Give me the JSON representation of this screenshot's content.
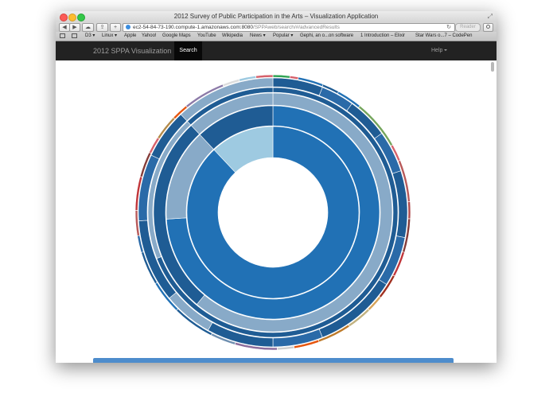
{
  "window": {
    "title": "2012 Survey of Public Participation in the Arts – Visualization Application"
  },
  "toolbar": {
    "back_label": "◀",
    "forward_label": "▶",
    "add_label": "+",
    "url_host": "ec2-54-84-73-190.compute-1.amazonaws.com:8080",
    "url_path": "/SPPAweb/search/#/advancedResults",
    "reader_label": "Reader"
  },
  "bookmarks": [
    "D3 ▾",
    "Linux ▾",
    "Apple",
    "Yahoo!",
    "Google Maps",
    "YouTube",
    "Wikipedia",
    "News ▾",
    "Popular ▾",
    "Gephi, an o...on software",
    "1 Introduction – Elixir",
    "Star Wars o...7 – CodePen"
  ],
  "navbar": {
    "brand": "2012 SPPA Visualization",
    "search_tab": "Search",
    "help_label": "Help"
  },
  "colors": {
    "navbar_bg": "#222222",
    "blue_dark": "#1f5c94",
    "blue_mid": "#2171b5",
    "blue_gray": "#88aac8",
    "blue_light": "#9ecae1",
    "bottom_bar": "#4d8ccc"
  },
  "sunburst": {
    "rings": [
      {
        "segments": [
          {
            "value": 88,
            "color": "#2171b5"
          },
          {
            "value": 12,
            "color": "#9ecae1"
          }
        ]
      },
      {
        "segments": [
          {
            "value": 74,
            "color": "#2171b5"
          },
          {
            "value": 14,
            "color": "#88aac8"
          },
          {
            "value": 12,
            "color": "#1f5c94"
          }
        ]
      },
      {
        "segments": [
          {
            "value": 61,
            "color": "#88aac8"
          },
          {
            "value": 27,
            "color": "#1f5c94"
          },
          {
            "value": 12,
            "color": "#88aac8"
          }
        ]
      },
      {
        "segments": [
          {
            "value": 69,
            "color": "#1f5c94"
          },
          {
            "value": 19,
            "color": "#88aac8"
          },
          {
            "value": 12,
            "color": "#1f5c94"
          }
        ]
      },
      {
        "segments": [
          {
            "value": 6,
            "color": "#1f5c94"
          },
          {
            "value": 4,
            "color": "#2a6aa8"
          },
          {
            "value": 5,
            "color": "#1f5c94"
          },
          {
            "value": 5,
            "color": "#2a6aa8"
          },
          {
            "value": 8,
            "color": "#1f5c94"
          },
          {
            "value": 6,
            "color": "#2a6aa8"
          },
          {
            "value": 10,
            "color": "#1f5c94"
          },
          {
            "value": 6,
            "color": "#2a6aa8"
          },
          {
            "value": 8,
            "color": "#1f5c94"
          },
          {
            "value": 6,
            "color": "#88aac8"
          },
          {
            "value": 10,
            "color": "#1f5c94"
          },
          {
            "value": 8,
            "color": "#2a6aa8"
          },
          {
            "value": 6,
            "color": "#1f5c94"
          },
          {
            "value": 12,
            "color": "#88aac8"
          }
        ]
      },
      {
        "segments": [
          {
            "value": 2,
            "color": "#31a354"
          },
          {
            "value": 1,
            "color": "#d6616b"
          },
          {
            "value": 3,
            "color": "#2171b5"
          },
          {
            "value": 2,
            "color": "#1f5c94"
          },
          {
            "value": 3,
            "color": "#2171b5"
          },
          {
            "value": 6,
            "color": "#74a55c"
          },
          {
            "value": 2,
            "color": "#d6616b"
          },
          {
            "value": 5,
            "color": "#b85a5a"
          },
          {
            "value": 2,
            "color": "#ad494a"
          },
          {
            "value": 4,
            "color": "#843c39"
          },
          {
            "value": 3,
            "color": "#c0353a"
          },
          {
            "value": 3,
            "color": "#a03020"
          },
          {
            "value": 2,
            "color": "#d6a35a"
          },
          {
            "value": 3,
            "color": "#c2b280"
          },
          {
            "value": 4,
            "color": "#bd7a2a"
          },
          {
            "value": 3,
            "color": "#e6550d"
          },
          {
            "value": 2,
            "color": "#cfcfcf"
          },
          {
            "value": 5,
            "color": "#8c6d9c"
          },
          {
            "value": 3,
            "color": "#6e8fb0"
          },
          {
            "value": 5,
            "color": "#1f5c94"
          },
          {
            "value": 4,
            "color": "#2171b5"
          },
          {
            "value": 4,
            "color": "#1f5c94"
          },
          {
            "value": 2,
            "color": "#2a6aa8"
          },
          {
            "value": 3,
            "color": "#b85a5a"
          },
          {
            "value": 4,
            "color": "#c0353a"
          },
          {
            "value": 3,
            "color": "#843c39"
          },
          {
            "value": 2,
            "color": "#d6616b"
          },
          {
            "value": 3,
            "color": "#b38a4a"
          },
          {
            "value": 2,
            "color": "#e6550d"
          },
          {
            "value": 5,
            "color": "#8c7aa8"
          },
          {
            "value": 2,
            "color": "#dddddd"
          },
          {
            "value": 2,
            "color": "#9ecae1"
          },
          {
            "value": 2,
            "color": "#d6616b"
          }
        ]
      }
    ]
  }
}
